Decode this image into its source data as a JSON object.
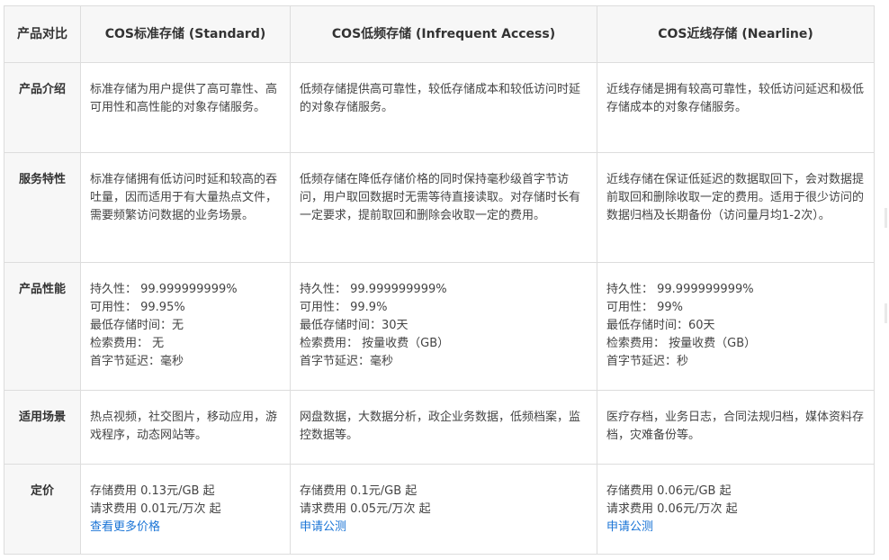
{
  "header": {
    "corner": "产品对比",
    "standard": "COS标准存储 (Standard)",
    "ia": "COS低频存储 (Infrequent Access)",
    "nearline": "COS近线存储 (Nearline)"
  },
  "rows": {
    "intro": {
      "label": "产品介绍",
      "standard": "标准存储为用户提供了高可靠性、高可用性和高性能的对象存储服务。",
      "ia": "低频存储提供高可靠性，较低存储成本和较低访问时延的对象存储服务。",
      "nearline": "近线存储是拥有较高可靠性，较低访问延迟和极低存储成本的对象存储服务。"
    },
    "features": {
      "label": "服务特性",
      "standard": "标准存储拥有低访问时延和较高的吞吐量，因而适用于有大量热点文件，需要频繁访问数据的业务场景。",
      "ia": "低频存储在降低存储价格的同时保持毫秒级首字节访问，用户取回数据时无需等待直接读取。对存储时长有一定要求，提前取回和删除会收取一定的费用。",
      "nearline": "近线存储在保证低延迟的数据取回下，会对数据提前取回和删除收取一定的费用。适用于很少访问的数据归档及长期备份（访问量月均1-2次）。"
    },
    "perf": {
      "label": "产品性能",
      "standard": [
        "持久性：  99.999999999%",
        "可用性：  99.95%",
        "最低存储时间：无",
        "检索费用：  无",
        "首字节延迟：毫秒"
      ],
      "ia": [
        "持久性：  99.999999999%",
        "可用性：  99.9%",
        "最低存储时间：30天",
        "检索费用：  按量收费（GB）",
        "首字节延迟：毫秒"
      ],
      "nearline": [
        "持久性：  99.999999999%",
        "可用性：  99%",
        "最低存储时间：60天",
        "检索费用：  按量收费（GB）",
        "首字节延迟：秒"
      ]
    },
    "scenarios": {
      "label": "适用场景",
      "standard": "热点视频，社交图片，移动应用，游戏程序，动态网站等。",
      "ia": "网盘数据，大数据分析，政企业务数据，低频档案，监控数据等。",
      "nearline": "医疗存档，业务日志，合同法规归档，媒体资料存档，灾难备份等。"
    },
    "pricing": {
      "label": "定价",
      "standard": [
        "存储费用 0.13元/GB 起",
        "请求费用 0.01元/万次 起"
      ],
      "standard_link": "查看更多价格",
      "ia": [
        "存储费用 0.1元/GB 起",
        "请求费用 0.05元/万次 起"
      ],
      "ia_link": "申请公测",
      "nearline": [
        "存储费用 0.06元/GB 起",
        "请求费用 0.06元/万次 起"
      ],
      "nearline_link": "申请公测"
    }
  },
  "colors": {
    "link": "#1a74d6",
    "header_bg": "#f7f7f7",
    "border": "#dddddd"
  }
}
